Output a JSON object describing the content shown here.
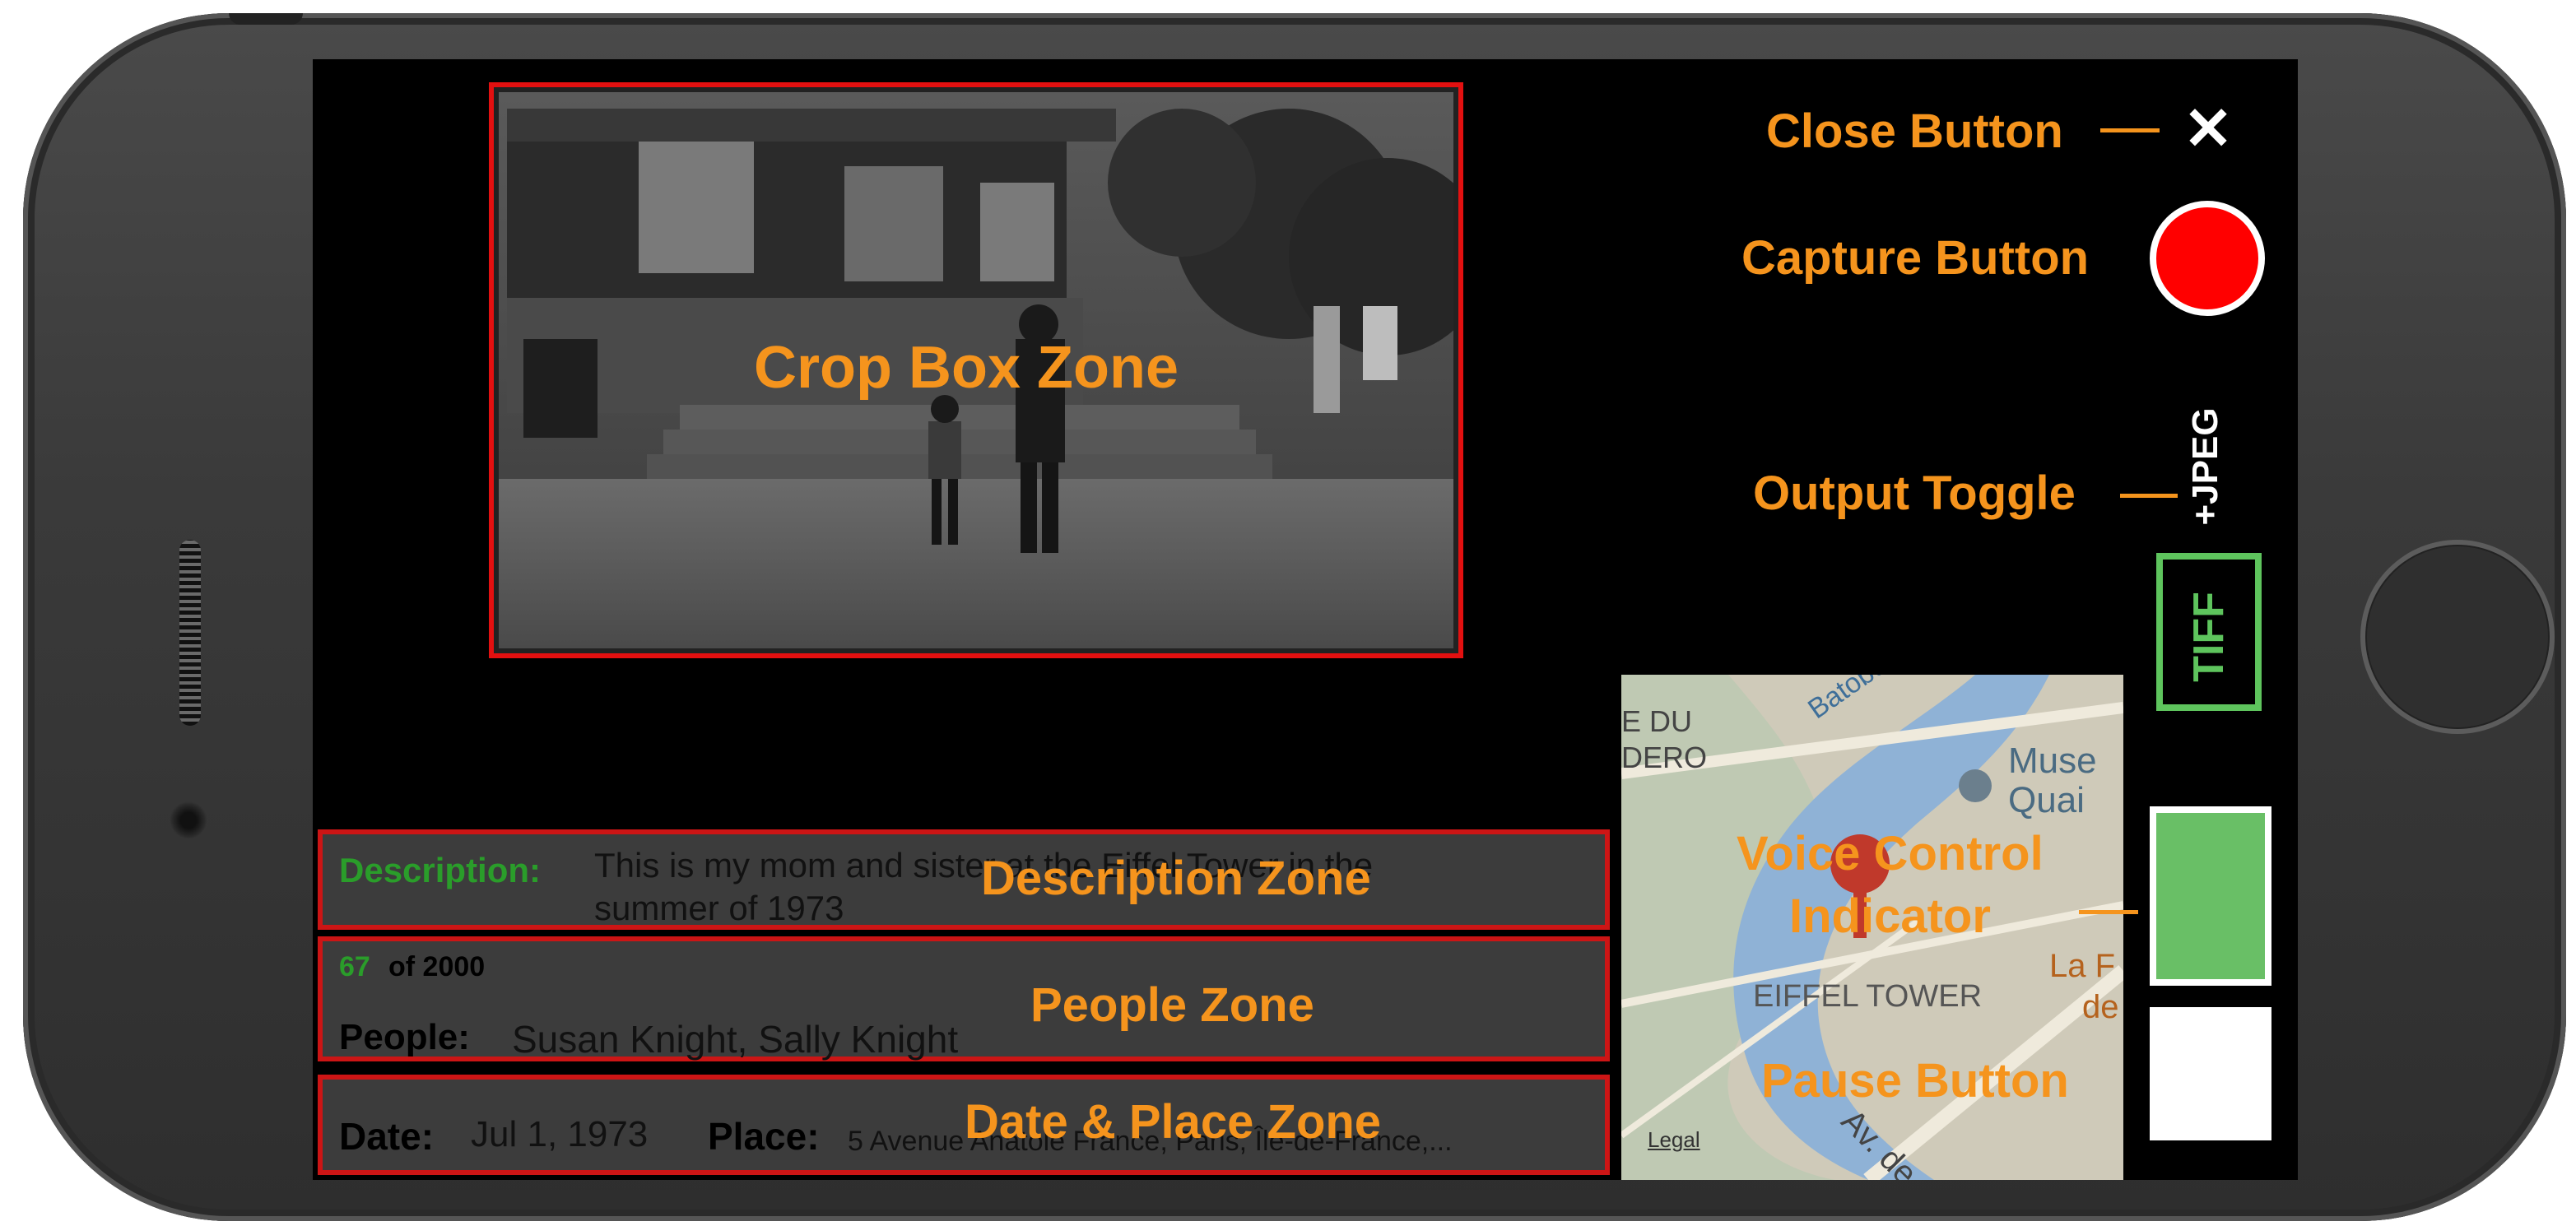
{
  "annotations": {
    "close_button": "Close Button",
    "capture_button": "Capture Button",
    "output_toggle": "Output Toggle",
    "voice_control_line1": "Voice Control",
    "voice_control_line2": "Indicator",
    "pause_button": "Pause Button",
    "crop_box_zone": "Crop Box Zone",
    "description_zone": "Description Zone",
    "people_zone": "People Zone",
    "date_place_zone": "Date & Place Zone"
  },
  "controls": {
    "close_glyph": "✕",
    "output_toggle_tiff": "TIFF",
    "output_toggle_jpeg": "+JPEG"
  },
  "description": {
    "label": "Description:",
    "text_line1": "This is my mom and sister at the Eiffel Tower in the",
    "text_line2": "summer of 1973"
  },
  "people": {
    "count_current": "67",
    "count_rest": "of 2000",
    "label": "People:",
    "value": "Susan Knight, Sally Knight"
  },
  "date_place": {
    "date_label": "Date:",
    "date_value": "Jul 1, 1973",
    "place_label": "Place:",
    "place_value": "5 Avenue Anatole France, Paris, Île-de-France,..."
  },
  "map": {
    "label_e_du": "E DU",
    "label_dero": "DERO",
    "label_batobus": "Batobus",
    "label_muse": "Muse",
    "label_quai": "Quai",
    "label_eiffel": "EIFFEL TOWER",
    "label_la": "La F",
    "label_de": "de",
    "label_av": "Av. de",
    "legal": "Legal"
  },
  "colors": {
    "annotation_orange": "#f5941d",
    "zone_red": "#e31010",
    "capture_red": "#ff0000",
    "toggle_green": "#5ec45d",
    "voice_green": "#69bf66",
    "description_label_green": "#2a9d2a"
  }
}
